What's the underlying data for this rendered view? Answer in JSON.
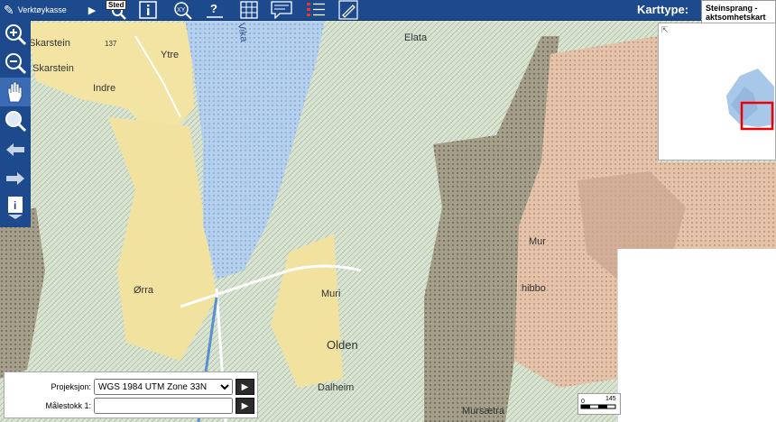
{
  "toolbar": {
    "toolkit_label": "Verktøykasse",
    "sted_label": "Sted",
    "karttype_label": "Karttype:",
    "karttype_value": "Steinsprang - aktsomhetskart",
    "buttons": [
      "search-place",
      "info",
      "xy-coordinates",
      "question",
      "grid",
      "comment",
      "legend",
      "edit"
    ]
  },
  "sidebar": {
    "tools": [
      "zoom-in",
      "zoom-out",
      "pan",
      "zoom-search",
      "back",
      "forward",
      "info-download"
    ]
  },
  "map": {
    "labels": {
      "skarstein_top": "Skarstein",
      "skarstein_2": "Skarstein",
      "ytre": "Ytre",
      "indre": "Indre",
      "elevation": "137",
      "vika": "Vika",
      "elata": "Elata",
      "orra": "Ørra",
      "muri": "Muri",
      "olden": "Olden",
      "dalheim": "Dalheim",
      "mur": "Mur",
      "hibbo": "hibbo",
      "mursaetra": "Mursætra"
    }
  },
  "scalebar": {
    "label": "145"
  },
  "projection": {
    "label": "Projeksjon:",
    "selected": "WGS 1984 UTM Zone 33N",
    "scale_label": "Målestokk 1:",
    "scale_value": ""
  }
}
